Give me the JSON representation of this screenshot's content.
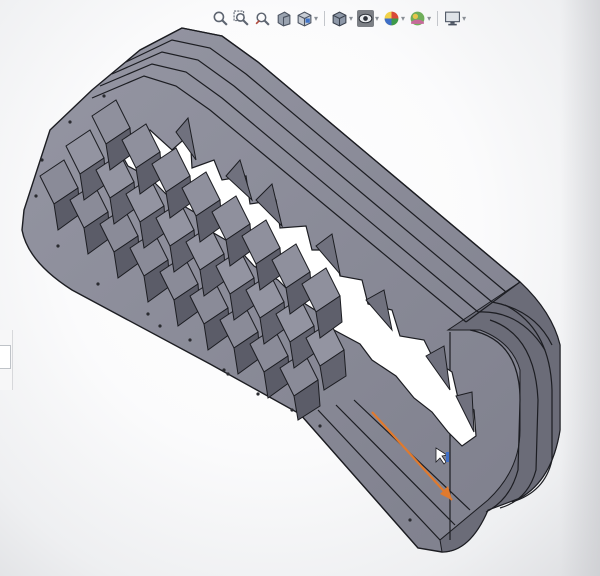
{
  "toolbar": {
    "icons": [
      "zoom-to-fit-icon",
      "zoom-to-area-icon",
      "previous-view-icon",
      "section-view-icon",
      "view-orientation-icon",
      "display-style-icon",
      "hide-show-items-icon",
      "edit-appearance-icon",
      "apply-scene-icon",
      "view-settings-icon"
    ]
  },
  "model": {
    "name_icon": "tank-track-3d-model",
    "colors": {
      "face_top": "#8c8d9a",
      "face_side": "#6f707d",
      "face_dark": "#52535e",
      "edge": "#1c1d22",
      "hole": "#ffffff",
      "dimension_arrow": "#e07a2e"
    }
  }
}
